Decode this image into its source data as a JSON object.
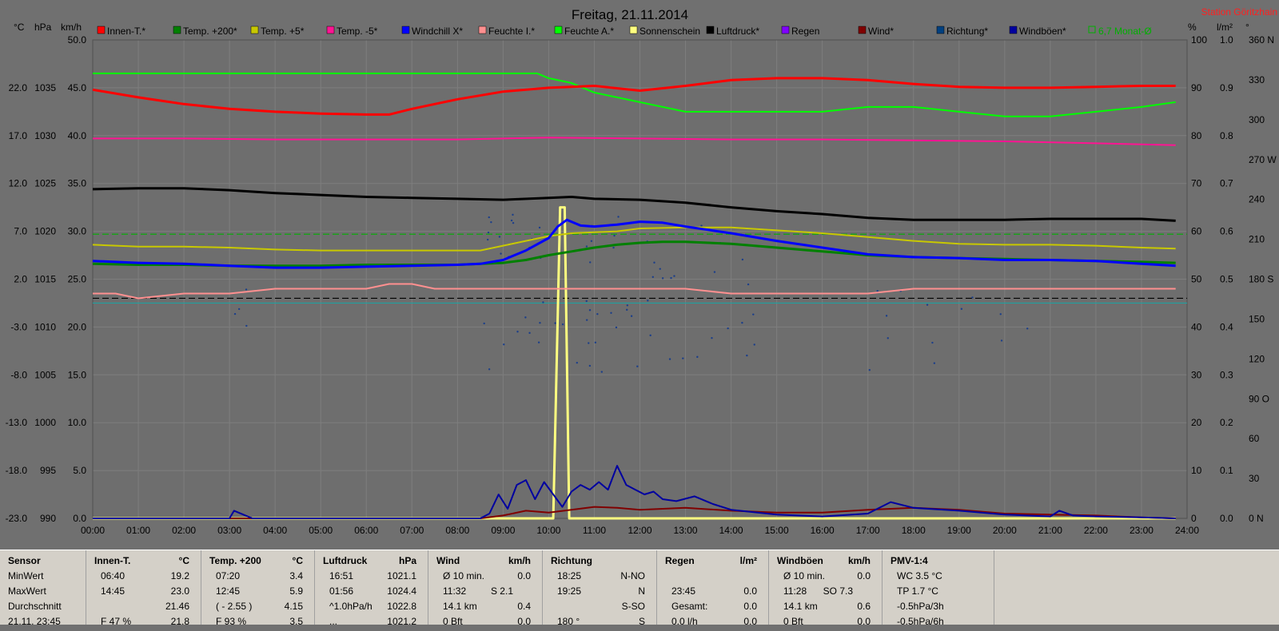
{
  "title": "Freitag, 21.11.2014",
  "station": "Station Göritzhain",
  "units": {
    "left1": "°C",
    "left2": "hPa",
    "left3": "km/h",
    "right1": "%",
    "right2": "l/m²",
    "right3": "°"
  },
  "legend": [
    {
      "label": "Innen-T.*",
      "color": "#ff0000"
    },
    {
      "label": "Temp. +200*",
      "color": "#008000"
    },
    {
      "label": "Temp. +5*",
      "color": "#c8c800"
    },
    {
      "label": "Temp. -5*",
      "color": "#ff1493"
    },
    {
      "label": "Windchill X*",
      "color": "#0000ff"
    },
    {
      "label": "Feuchte I.*",
      "color": "#ff9090"
    },
    {
      "label": "Feuchte A.*",
      "color": "#00ff00"
    },
    {
      "label": "Sonnenschein",
      "color": "#ffff80"
    },
    {
      "label": "Luftdruck*",
      "color": "#000000"
    },
    {
      "label": "Regen",
      "color": "#8000ff"
    },
    {
      "label": "Wind*",
      "color": "#800000"
    },
    {
      "label": "Richtung*",
      "color": "#004080"
    },
    {
      "label": "Windböen*",
      "color": "#0000a0"
    },
    {
      "label": "6,7 Monat-Ø",
      "color": "#00b000"
    }
  ],
  "chart_data": {
    "type": "line",
    "title": "Freitag, 21.11.2014",
    "x_ticks": [
      "00:00",
      "01:00",
      "02:00",
      "03:00",
      "04:00",
      "05:00",
      "06:00",
      "07:00",
      "08:00",
      "09:00",
      "10:00",
      "11:00",
      "12:00",
      "13:00",
      "14:00",
      "15:00",
      "16:00",
      "17:00",
      "18:00",
      "19:00",
      "20:00",
      "21:00",
      "22:00",
      "23:00",
      "24:00"
    ],
    "axes": {
      "temp_c": {
        "ticks": [
          "22.0",
          "17.0",
          "12.0",
          "7.0",
          "2.0",
          "-3.0",
          "-8.0",
          "-13.0",
          "-18.0",
          "-23.0"
        ],
        "range": [
          -23,
          27
        ]
      },
      "pressure_hpa": {
        "ticks": [
          "1035",
          "1030",
          "1025",
          "1020",
          "1015",
          "1010",
          "1005",
          "1000",
          "995",
          "990"
        ],
        "range": [
          990,
          1040
        ]
      },
      "wind_kmh": {
        "ticks": [
          "50.0",
          "45.0",
          "40.0",
          "35.0",
          "30.0",
          "25.0",
          "20.0",
          "15.0",
          "10.0",
          "5.0",
          "0.0"
        ],
        "range": [
          0,
          50
        ]
      },
      "percent": {
        "ticks": [
          "100",
          "90",
          "80",
          "70",
          "60",
          "50",
          "40",
          "30",
          "20",
          "10",
          "0"
        ],
        "range": [
          0,
          100
        ]
      },
      "rain_lm2": {
        "ticks": [
          "1.0",
          "0.9",
          "0.8",
          "0.7",
          "0.6",
          "0.5",
          "0.4",
          "0.3",
          "0.2",
          "0.1",
          "0.0"
        ],
        "range": [
          0,
          1
        ]
      },
      "direction": {
        "ticks": [
          "360 N",
          "330",
          "300",
          "270 W",
          "240",
          "210",
          "180 S",
          "150",
          "120",
          "90 O",
          "60",
          "30",
          "0 N"
        ],
        "range": [
          0,
          360
        ]
      }
    },
    "grid": true,
    "reference_lines": [
      {
        "name": "0 °C",
        "axis": "temp_c",
        "value": 0,
        "style": "dashed",
        "color": "#000000"
      },
      {
        "name": "6,7 Monat-Ø",
        "axis": "temp_c",
        "value": 6.7,
        "style": "dashed",
        "color": "#00b000"
      },
      {
        "axis": "temp_c",
        "value": -0.5,
        "style": "solid",
        "color": "#20a0a0"
      }
    ],
    "series": [
      {
        "name": "Innen-T.*",
        "axis": "temp_c",
        "color": "#ff0000",
        "width": 3,
        "x": [
          0,
          1,
          2,
          3,
          4,
          5,
          6,
          6.5,
          7,
          8,
          9,
          10,
          10.5,
          11,
          12,
          13,
          14,
          15,
          16,
          17,
          18,
          19,
          20,
          21,
          22,
          23,
          23.75
        ],
        "y": [
          21.8,
          21.0,
          20.3,
          19.8,
          19.5,
          19.3,
          19.2,
          19.2,
          19.8,
          20.8,
          21.6,
          22.0,
          22.1,
          22.2,
          21.7,
          22.2,
          22.8,
          23.0,
          23.0,
          22.8,
          22.4,
          22.1,
          22.0,
          22.0,
          22.1,
          22.2,
          22.2
        ]
      },
      {
        "name": "Feuchte A.*",
        "axis": "percent",
        "color": "#00ff00",
        "width": 2,
        "x": [
          0,
          1,
          2,
          3,
          4,
          5,
          6,
          7,
          8,
          9,
          9.75,
          10,
          10.5,
          11,
          11.5,
          12,
          12.5,
          13,
          14,
          15,
          16,
          17,
          18,
          19,
          20,
          21,
          22,
          23,
          23.75
        ],
        "y": [
          93,
          93,
          93,
          93,
          93,
          93,
          93,
          93,
          93,
          93,
          93,
          92,
          91,
          89,
          88,
          87,
          86,
          85,
          85,
          85,
          85,
          86,
          86,
          85,
          84,
          84,
          85,
          86,
          87
        ]
      },
      {
        "name": "Temp. -5*",
        "axis": "temp_c",
        "color": "#ff1493",
        "width": 2,
        "x": [
          0,
          2,
          4,
          6,
          8,
          10,
          12,
          14,
          16,
          18,
          20,
          22,
          23.75
        ],
        "y": [
          16.7,
          16.7,
          16.6,
          16.6,
          16.6,
          16.8,
          16.7,
          16.6,
          16.6,
          16.5,
          16.4,
          16.2,
          16.0
        ]
      },
      {
        "name": "Luftdruck*",
        "axis": "pressure_hpa",
        "color": "#000000",
        "width": 3,
        "x": [
          0,
          1,
          2,
          3,
          4,
          5,
          6,
          7,
          8,
          9,
          10,
          10.5,
          11,
          12,
          13,
          14,
          15,
          16,
          17,
          18,
          19,
          20,
          21,
          22,
          23,
          23.75
        ],
        "y": [
          1024.4,
          1024.5,
          1024.5,
          1024.3,
          1024.0,
          1023.8,
          1023.6,
          1023.5,
          1023.4,
          1023.3,
          1023.5,
          1023.6,
          1023.4,
          1023.3,
          1023.0,
          1022.5,
          1022.1,
          1021.8,
          1021.4,
          1021.2,
          1021.2,
          1021.2,
          1021.3,
          1021.3,
          1021.3,
          1021.1
        ]
      },
      {
        "name": "Temp. +5*",
        "axis": "temp_c",
        "color": "#c8c800",
        "width": 2,
        "x": [
          0,
          1,
          2,
          3,
          4,
          5,
          6,
          7,
          8,
          8.5,
          9,
          9.5,
          10,
          10.5,
          11,
          11.5,
          12,
          13,
          14,
          15,
          16,
          17,
          18,
          19,
          20,
          21,
          22,
          23,
          23.75
        ],
        "y": [
          5.6,
          5.4,
          5.4,
          5.3,
          5.1,
          5.0,
          5.0,
          5.0,
          5.0,
          5.0,
          5.5,
          6.0,
          6.5,
          6.8,
          6.9,
          7.0,
          7.3,
          7.4,
          7.4,
          7.1,
          6.8,
          6.4,
          6.0,
          5.7,
          5.6,
          5.6,
          5.5,
          5.3,
          5.2
        ]
      },
      {
        "name": "Temp. +200*",
        "axis": "temp_c",
        "color": "#008000",
        "width": 3,
        "x": [
          0,
          1,
          2,
          3,
          4,
          5,
          6,
          7,
          8,
          8.5,
          9,
          9.5,
          10,
          10.5,
          11,
          11.5,
          12,
          12.5,
          13,
          14,
          15,
          16,
          17,
          18,
          19,
          20,
          21,
          22,
          23,
          23.75
        ],
        "y": [
          3.6,
          3.5,
          3.5,
          3.4,
          3.4,
          3.4,
          3.5,
          3.5,
          3.5,
          3.6,
          3.7,
          4.0,
          4.5,
          4.9,
          5.3,
          5.6,
          5.8,
          5.9,
          5.9,
          5.7,
          5.3,
          4.9,
          4.5,
          4.3,
          4.2,
          4.1,
          4.0,
          3.9,
          3.8,
          3.7
        ]
      },
      {
        "name": "Windchill X*",
        "axis": "temp_c",
        "color": "#0000ff",
        "width": 3,
        "x": [
          0,
          1,
          2,
          3,
          4,
          5,
          6,
          7,
          8,
          8.5,
          9,
          9.5,
          10,
          10.2,
          10.4,
          10.7,
          11,
          11.5,
          12,
          12.5,
          13,
          14,
          15,
          16,
          17,
          18,
          19,
          20,
          21,
          22,
          23,
          23.75
        ],
        "y": [
          3.9,
          3.7,
          3.6,
          3.4,
          3.2,
          3.2,
          3.3,
          3.4,
          3.5,
          3.6,
          4.0,
          5.0,
          6.3,
          7.5,
          8.2,
          7.6,
          7.5,
          7.7,
          8.0,
          7.9,
          7.5,
          6.8,
          6.0,
          5.3,
          4.6,
          4.3,
          4.2,
          4.0,
          4.0,
          3.9,
          3.6,
          3.4
        ]
      },
      {
        "name": "Feuchte I.*",
        "axis": "percent",
        "color": "#ff9090",
        "width": 2,
        "x": [
          0,
          0.5,
          1,
          2,
          3,
          4,
          5,
          6,
          6.5,
          7,
          7.5,
          8,
          8.5,
          9,
          10,
          11,
          12,
          13,
          14,
          15,
          16,
          17,
          18,
          19,
          20,
          21,
          22,
          23,
          23.75
        ],
        "y": [
          47,
          47,
          46,
          47,
          47,
          48,
          48,
          48,
          49,
          49,
          48,
          48,
          48,
          48,
          48,
          48,
          48,
          48,
          47,
          47,
          47,
          47,
          48,
          48,
          48,
          48,
          48,
          48,
          48
        ]
      },
      {
        "name": "Sonnenschein",
        "axis": "percent",
        "color": "#ffff80",
        "width": 3,
        "x": [
          0,
          10.1,
          10.25,
          10.35,
          10.45,
          10.6,
          23.75
        ],
        "y": [
          0,
          0,
          65,
          65,
          0,
          0,
          0
        ]
      },
      {
        "name": "Windböen*",
        "axis": "wind_kmh",
        "color": "#0000a0",
        "width": 2,
        "x": [
          0,
          3.0,
          3.1,
          3.3,
          3.5,
          8.5,
          8.7,
          8.9,
          9.1,
          9.3,
          9.5,
          9.7,
          9.9,
          10.1,
          10.3,
          10.5,
          10.7,
          10.9,
          11.1,
          11.3,
          11.5,
          11.7,
          11.9,
          12.1,
          12.3,
          12.5,
          12.8,
          13.2,
          13.6,
          14,
          15,
          16,
          17,
          17.5,
          18,
          19,
          20,
          21,
          21.2,
          21.5,
          22,
          23,
          23.75
        ],
        "y": [
          0,
          0,
          0.8,
          0.4,
          0,
          0,
          0.5,
          2.5,
          1.0,
          3.5,
          4.0,
          2.0,
          3.8,
          2.5,
          1.2,
          2.8,
          3.5,
          3.0,
          3.8,
          3.0,
          5.5,
          3.5,
          3.0,
          2.5,
          2.8,
          2.0,
          1.8,
          2.3,
          1.5,
          0.9,
          0.4,
          0.2,
          0.5,
          1.7,
          1.1,
          0.8,
          0.4,
          0.2,
          0.8,
          0.3,
          0.2,
          0.1,
          0
        ]
      },
      {
        "name": "Wind*",
        "axis": "wind_kmh",
        "color": "#800000",
        "width": 2,
        "x": [
          0,
          8.5,
          9,
          9.5,
          10,
          10.5,
          11,
          11.5,
          12,
          12.5,
          13,
          14,
          15,
          16,
          17,
          18,
          19,
          20,
          21,
          22,
          23,
          23.75
        ],
        "y": [
          0,
          0,
          0.3,
          0.8,
          0.6,
          0.9,
          1.2,
          1.1,
          0.9,
          1.0,
          1.1,
          0.8,
          0.6,
          0.6,
          0.9,
          1.1,
          0.9,
          0.5,
          0.4,
          0.3,
          0.1,
          0
        ]
      }
    ]
  },
  "summary": {
    "columns": [
      {
        "header": [
          "Sensor",
          "",
          ""
        ],
        "rows": [
          [
            "MinWert",
            "",
            ""
          ],
          [
            "MaxWert",
            "",
            ""
          ],
          [
            "Durchschnitt",
            "",
            ""
          ],
          [
            "21.11. 23:45",
            "",
            ""
          ]
        ]
      },
      {
        "header": [
          "Innen-T.",
          "",
          "°C"
        ],
        "rows": [
          [
            "06:40",
            "",
            "19.2"
          ],
          [
            "14:45",
            "",
            "23.0"
          ],
          [
            "",
            "",
            "21.46"
          ],
          [
            "F 47 %",
            "",
            "21.8"
          ]
        ]
      },
      {
        "header": [
          "Temp. +200",
          "",
          "°C"
        ],
        "rows": [
          [
            "07:20",
            "",
            "3.4"
          ],
          [
            "12:45",
            "",
            "5.9"
          ],
          [
            "( - 2.55 )",
            "",
            "4.15"
          ],
          [
            "F 93 %",
            "",
            "3.5"
          ]
        ]
      },
      {
        "header": [
          "Luftdruck",
          "",
          "hPa"
        ],
        "rows": [
          [
            "16:51",
            "",
            "1021.1"
          ],
          [
            "01:56",
            "",
            "1024.4"
          ],
          [
            "^1.0hPa/h",
            "",
            "1022.8"
          ],
          [
            "...",
            "",
            "1021.2"
          ]
        ]
      },
      {
        "header": [
          "Wind",
          "",
          "km/h"
        ],
        "rows": [
          [
            "Ø 10 min.",
            "",
            "0.0"
          ],
          [
            "11:32",
            "S 2.1",
            ""
          ],
          [
            "14.1 km",
            "",
            "0.4"
          ],
          [
            "0 Bft",
            "",
            "0.0"
          ]
        ]
      },
      {
        "header": [
          "Richtung",
          "",
          ""
        ],
        "rows": [
          [
            "18:25",
            "",
            "N-NO"
          ],
          [
            "19:25",
            "",
            "N"
          ],
          [
            "",
            "",
            "S-SO"
          ],
          [
            "180 °",
            "",
            "S"
          ]
        ]
      },
      {
        "header": [
          "Regen",
          "",
          "l/m²"
        ],
        "rows": [
          [
            "",
            "",
            ""
          ],
          [
            "23:45",
            "",
            "0.0"
          ],
          [
            "Gesamt:",
            "",
            "0.0"
          ],
          [
            "0.0 l/h",
            "",
            "0.0"
          ]
        ]
      },
      {
        "header": [
          "Windböen",
          "",
          "km/h"
        ],
        "rows": [
          [
            "Ø 10 min.",
            "",
            "0.0"
          ],
          [
            "11:28",
            "SO 7.3",
            ""
          ],
          [
            "14.1 km",
            "",
            "0.6"
          ],
          [
            "0 Bft",
            "",
            "0.0"
          ]
        ]
      },
      {
        "header": [
          "PMV-1:4",
          "",
          ""
        ],
        "rows": [
          [
            "WC 3.5 °C",
            "",
            ""
          ],
          [
            "TP 1.7 °C",
            "",
            ""
          ],
          [
            "-0.5hPa/3h",
            "",
            ""
          ],
          [
            "-0.5hPa/6h",
            "",
            ""
          ]
        ]
      }
    ]
  }
}
